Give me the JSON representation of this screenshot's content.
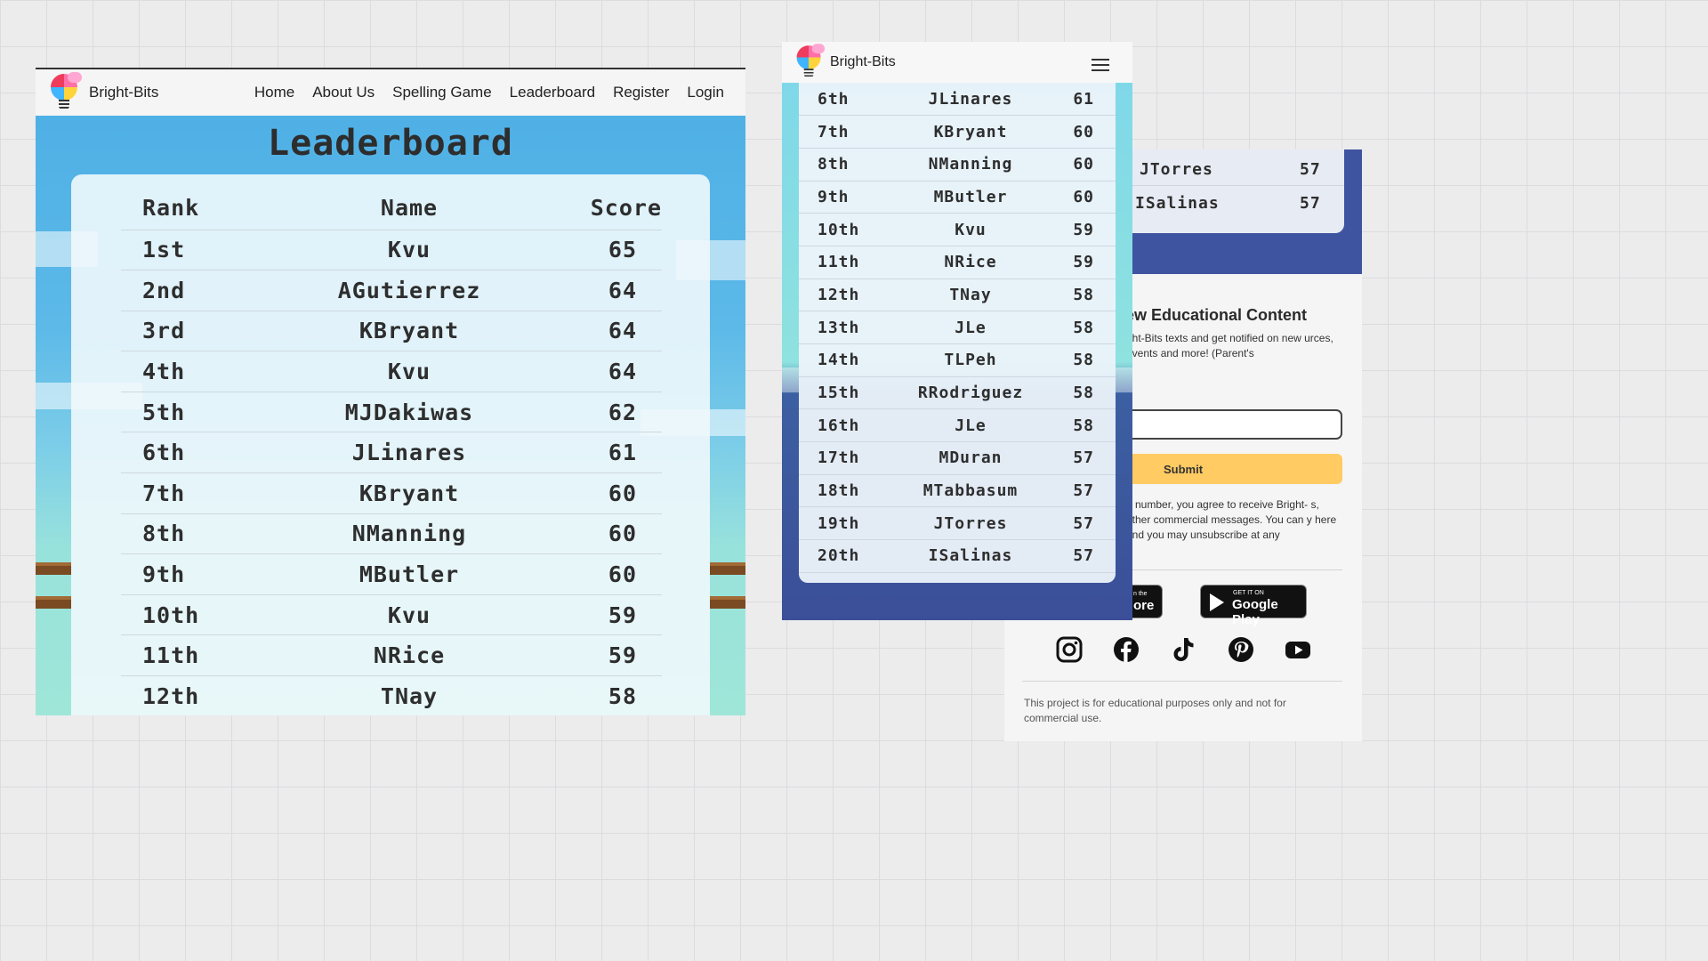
{
  "desktop": {
    "brand": "Bright-Bits",
    "nav": [
      "Home",
      "About Us",
      "Spelling Game",
      "Leaderboard",
      "Register",
      "Login"
    ],
    "title": "Leaderboard",
    "headers": {
      "rank": "Rank",
      "name": "Name",
      "score": "Score"
    },
    "rows": [
      {
        "rank": "1st",
        "name": "Kvu",
        "score": "65"
      },
      {
        "rank": "2nd",
        "name": "AGutierrez",
        "score": "64"
      },
      {
        "rank": "3rd",
        "name": "KBryant",
        "score": "64"
      },
      {
        "rank": "4th",
        "name": "Kvu",
        "score": "64"
      },
      {
        "rank": "5th",
        "name": "MJDakiwas",
        "score": "62"
      },
      {
        "rank": "6th",
        "name": "JLinares",
        "score": "61"
      },
      {
        "rank": "7th",
        "name": "KBryant",
        "score": "60"
      },
      {
        "rank": "8th",
        "name": "NManning",
        "score": "60"
      },
      {
        "rank": "9th",
        "name": "MButler",
        "score": "60"
      },
      {
        "rank": "10th",
        "name": "Kvu",
        "score": "59"
      },
      {
        "rank": "11th",
        "name": "NRice",
        "score": "59"
      },
      {
        "rank": "12th",
        "name": "TNay",
        "score": "58"
      }
    ]
  },
  "mobile": {
    "brand": "Bright-Bits",
    "menu_icon": "hamburger-menu-icon",
    "rows": [
      {
        "rank": "6th",
        "name": "JLinares",
        "score": "61"
      },
      {
        "rank": "7th",
        "name": "KBryant",
        "score": "60"
      },
      {
        "rank": "8th",
        "name": "NManning",
        "score": "60"
      },
      {
        "rank": "9th",
        "name": "MButler",
        "score": "60"
      },
      {
        "rank": "10th",
        "name": "Kvu",
        "score": "59"
      },
      {
        "rank": "11th",
        "name": "NRice",
        "score": "59"
      },
      {
        "rank": "12th",
        "name": "TNay",
        "score": "58"
      },
      {
        "rank": "13th",
        "name": "JLe",
        "score": "58"
      },
      {
        "rank": "14th",
        "name": "TLPeh",
        "score": "58"
      },
      {
        "rank": "15th",
        "name": "RRodriguez",
        "score": "58"
      },
      {
        "rank": "16th",
        "name": "JLe",
        "score": "58"
      },
      {
        "rank": "17th",
        "name": "MDuran",
        "score": "57"
      },
      {
        "rank": "18th",
        "name": "MTabbasum",
        "score": "57"
      },
      {
        "rank": "19th",
        "name": "JTorres",
        "score": "57"
      },
      {
        "rank": "20th",
        "name": "ISalinas",
        "score": "57"
      }
    ]
  },
  "footer": {
    "mini_rows": [
      {
        "name": "JTorres",
        "score": "57"
      },
      {
        "name": "ISalinas",
        "score": "57"
      }
    ],
    "heading": "ew Educational Content",
    "description": "ght-Bits texts and get notified on new urces, events and more! (Parent's",
    "submit_label": "Submit",
    "consent": "e number, you agree to receive Bright- s, other commercial messages. You can y here and you may unsubscribe at any",
    "app_store": {
      "small": "n the",
      "big": "ore"
    },
    "google_play": {
      "small": "GET IT ON",
      "big": "Google Play"
    },
    "social_icons": [
      "instagram-icon",
      "facebook-icon",
      "tiktok-icon",
      "pinterest-icon",
      "youtube-icon"
    ],
    "disclaimer": "This project is for educational purposes only and not for commercial use."
  },
  "colors": {
    "sky": "#5cb9e8",
    "water": "#3b4f98",
    "submit": "#ffcb62",
    "card": "#f0f8fc"
  }
}
